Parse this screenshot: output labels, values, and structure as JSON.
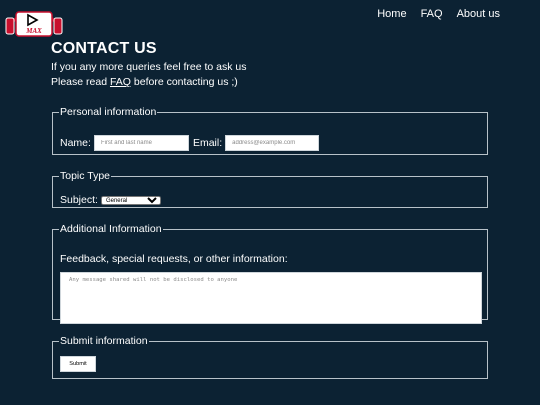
{
  "brand": {
    "logo_text": "MAX",
    "color": "#c8102e"
  },
  "nav": {
    "home": "Home",
    "faq": "FAQ",
    "about": "About us"
  },
  "page": {
    "heading": "CONTACT US",
    "intro_line1": "If you any more queries feel free to ask us",
    "intro_pre": "Please read ",
    "intro_link": "FAQ",
    "intro_post": " before contacting us ;)"
  },
  "personal": {
    "legend": "Personal information",
    "name_label": "Name:",
    "name_placeholder": "First and last name",
    "email_label": "Email:",
    "email_placeholder": "address@example.com"
  },
  "topic": {
    "legend": "Topic Type",
    "subject_label": "Subject:",
    "subject_selected": "General"
  },
  "additional": {
    "legend": "Additional Information",
    "prompt": "Feedback, special requests, or other information:",
    "message_placeholder": "Any message shared will not be disclosed to anyone"
  },
  "submit": {
    "legend": "Submit information",
    "button_label": "Submit"
  },
  "colors": {
    "background": "#0c2233",
    "border": "#b8c2c9",
    "text": "#ffffff"
  }
}
